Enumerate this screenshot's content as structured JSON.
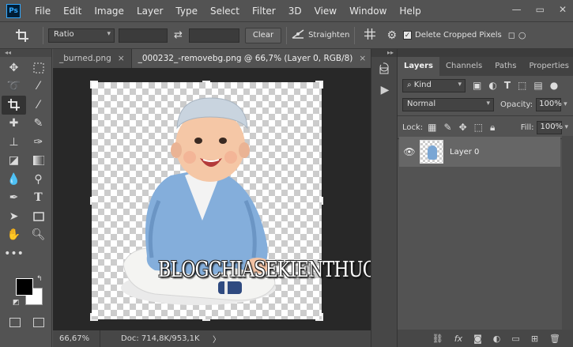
{
  "menubar": {
    "logo": "Ps",
    "items": [
      "File",
      "Edit",
      "Image",
      "Layer",
      "Type",
      "Select",
      "Filter",
      "3D",
      "View",
      "Window",
      "Help"
    ],
    "window_controls": [
      "—",
      "▭",
      "✕"
    ]
  },
  "options": {
    "ratio_select": "Ratio",
    "clear_label": "Clear",
    "straighten_label": "Straighten",
    "delete_cropped_label": "Delete Cropped Pixels",
    "swap_glyph": "⇄"
  },
  "tabs": [
    {
      "label": "_burned.png"
    },
    {
      "label": "_000232_-removebg.png @ 66,7% (Layer 0, RGB/8)"
    }
  ],
  "tab_close": "×",
  "status": {
    "zoom": "66,67%",
    "doc": "Doc: 714,8K/953,1K",
    "arrow": "〉"
  },
  "watermark": "BLOGCHIASEKIENTHUC.COM",
  "panel": {
    "tabs": [
      "Layers",
      "Channels",
      "Paths",
      "Properties"
    ],
    "kind_label": "Kind",
    "blend_mode": "Normal",
    "opacity_label": "Opacity:",
    "opacity_value": "100%",
    "lock_label": "Lock:",
    "fill_label": "Fill:",
    "fill_value": "100%",
    "layers": [
      {
        "name": "Layer 0",
        "visible": true
      }
    ]
  },
  "colors": {
    "ui_bg": "#535353",
    "canvas_bg": "#282828",
    "foreground_color": "#000000",
    "background_color": "#ffffff",
    "photoshop_blue": "#31a8ff"
  }
}
